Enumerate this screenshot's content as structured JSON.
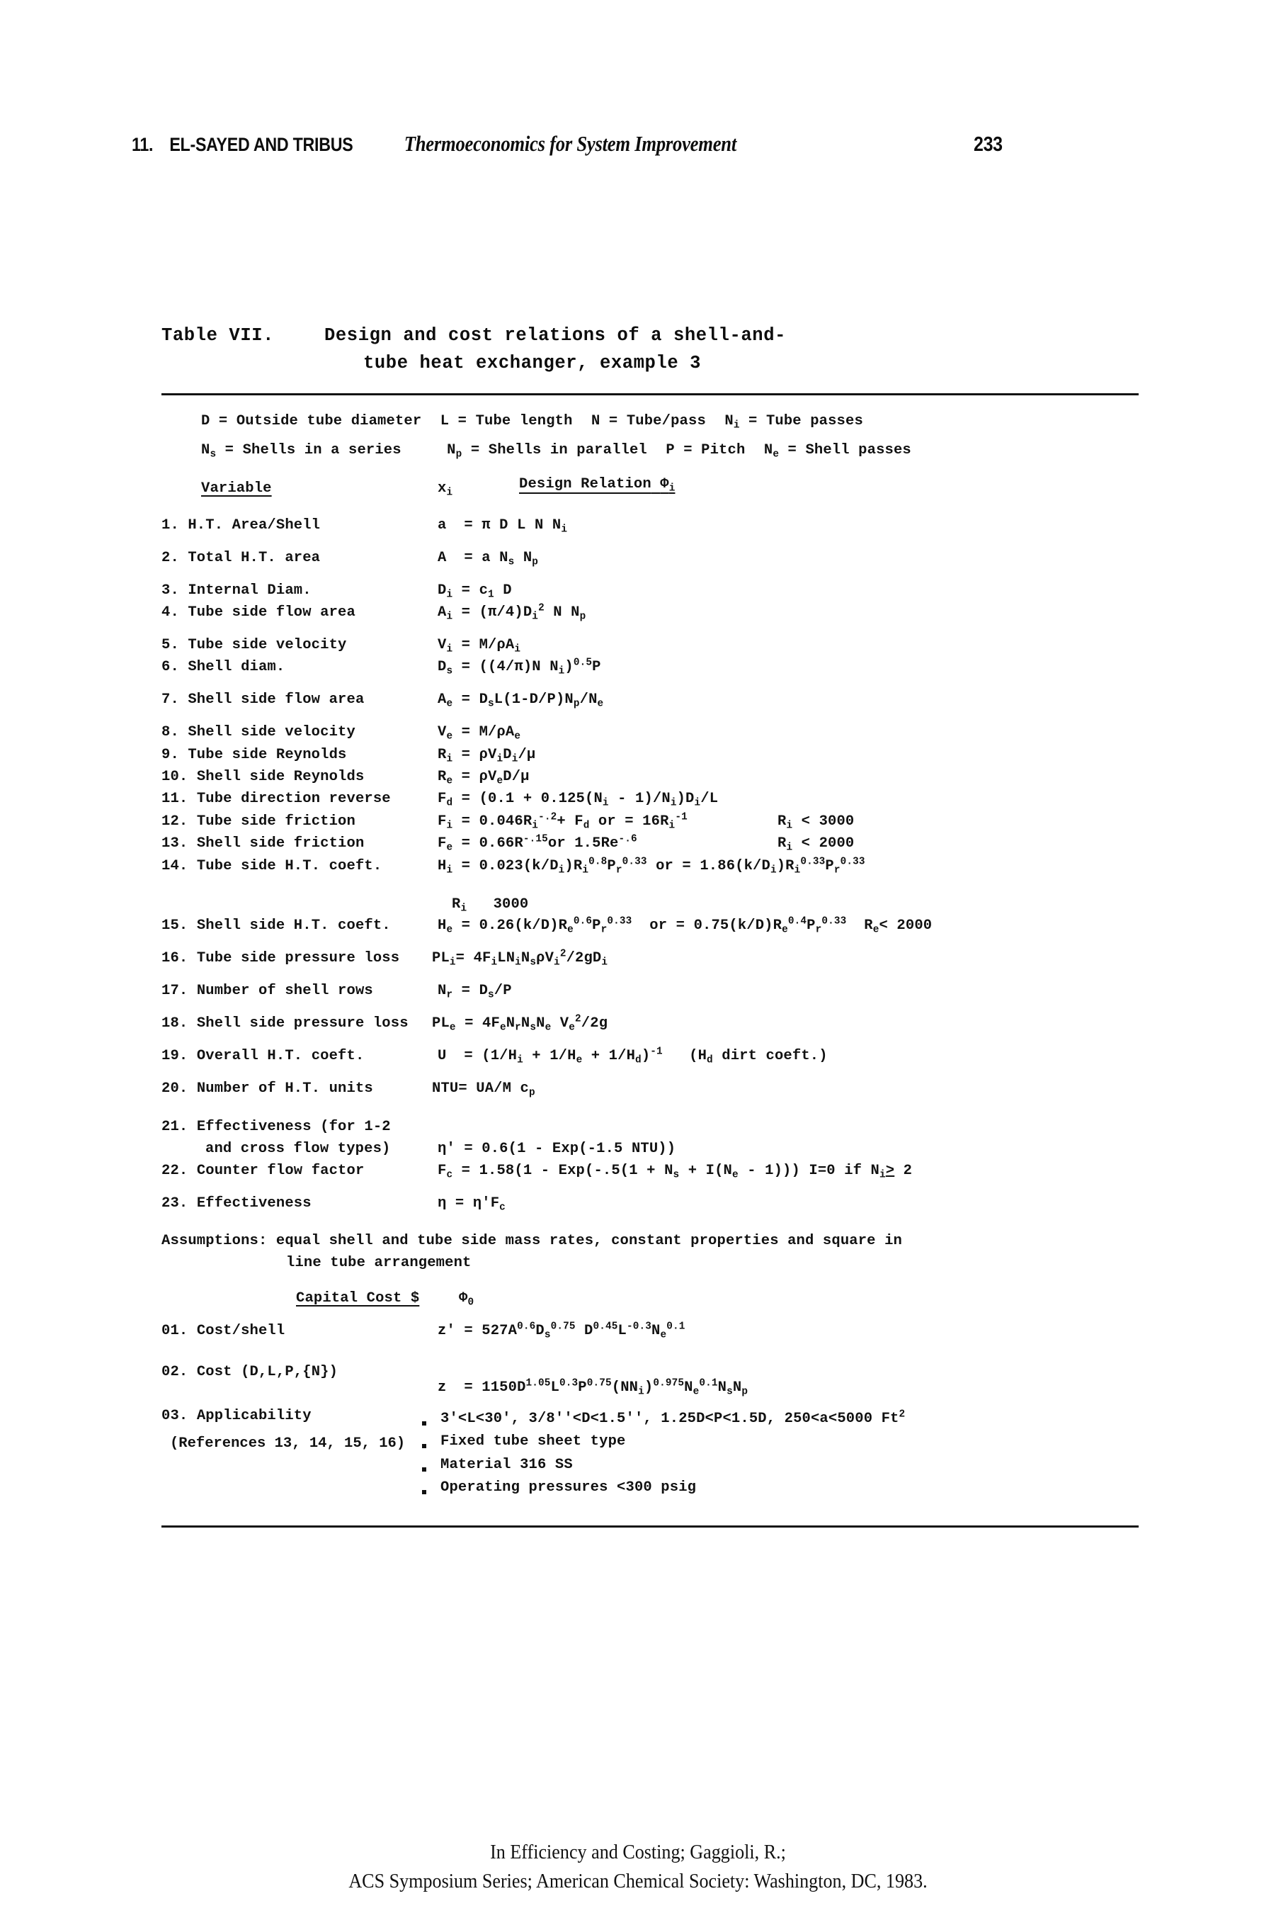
{
  "running_head": {
    "chapter_number": "11.",
    "authors": "EL-SAYED AND TRIBUS",
    "title": "Thermoeconomics for System Improvement",
    "page_number": "233"
  },
  "table": {
    "label": "Table VII.",
    "caption_line1": "Design and cost relations of a shell-and-",
    "caption_line2": "tube heat exchanger, example 3",
    "nomenclature": {
      "line1": [
        {
          "symbol": "D",
          "eq": "=",
          "text": "Outside tube diameter"
        },
        {
          "symbol": "L",
          "eq": "=",
          "text": "Tube length"
        },
        {
          "symbol": "N",
          "eq": "=",
          "text": "Tube/pass"
        },
        {
          "symbol": "N",
          "sub": "i",
          "eq": "=",
          "text": "Tube passes"
        }
      ],
      "line2": [
        {
          "symbol": "N",
          "sub": "s",
          "eq": "=",
          "text": "Shells in a series"
        },
        {
          "symbol": "N",
          "sub": "p",
          "eq": "=",
          "text": "Shells in parallel"
        },
        {
          "symbol": "P",
          "eq": "=",
          "text": "Pitch"
        },
        {
          "symbol": "N",
          "sub": "e",
          "eq": "=",
          "text": "Shell passes"
        }
      ]
    },
    "columns": {
      "variable": "Variable",
      "xi_base": "x",
      "xi_sub": "i",
      "relation": "Design Relation",
      "relation_symbol": "Φ",
      "relation_sub": "i"
    },
    "rows": [
      {
        "n": "1.",
        "name": "H.T. Area/Shell"
      },
      {
        "n": "2.",
        "name": "Total H.T. area"
      },
      {
        "n": "3.",
        "name": "Internal Diam."
      },
      {
        "n": "4.",
        "name": "Tube side flow area"
      },
      {
        "n": "5.",
        "name": "Tube side velocity"
      },
      {
        "n": "6.",
        "name": "Shell diam."
      },
      {
        "n": "7.",
        "name": "Shell side flow area"
      },
      {
        "n": "8.",
        "name": "Shell side velocity"
      },
      {
        "n": "9.",
        "name": "Tube side Reynolds"
      },
      {
        "n": "10.",
        "name": "Shell side Reynolds"
      },
      {
        "n": "11.",
        "name": "Tube direction reverse"
      },
      {
        "n": "12.",
        "name": "Tube side friction",
        "condition": "R_i < 3000"
      },
      {
        "n": "13.",
        "name": "Shell side friction",
        "condition": "R_i < 2000"
      },
      {
        "n": "14.",
        "name": "Tube side H.T. coeft.",
        "condition": "R_i  3000"
      },
      {
        "n": "15.",
        "name": "Shell side H.T. coeft.",
        "condition": "R_e< 2000"
      },
      {
        "n": "16.",
        "name": "Tube side pressure loss"
      },
      {
        "n": "17.",
        "name": "Number of shell rows"
      },
      {
        "n": "18.",
        "name": "Shell side pressure loss"
      },
      {
        "n": "19.",
        "name": "Overall H.T. coeft.",
        "note": "(H_d dirt coeft.)"
      },
      {
        "n": "20.",
        "name": "Number of H.T. units"
      },
      {
        "n": "21.",
        "name": "Effectiveness (for 1-2",
        "name2": "and cross flow types)"
      },
      {
        "n": "22.",
        "name": "Counter flow factor"
      },
      {
        "n": "23.",
        "name": "Effectiveness"
      }
    ],
    "assumptions": {
      "label": "Assumptions:",
      "line1": "equal shell and tube side mass rates, constant properties and square in",
      "line2": "line tube arrangement"
    },
    "capital_cost": {
      "heading": "Capital Cost $",
      "phi_symbol": "Φ",
      "phi_sub": "0",
      "rows": [
        {
          "n": "01.",
          "name": "Cost/shell"
        },
        {
          "n": "02.",
          "name": "Cost (D,L,P,{N})"
        },
        {
          "n": "03.",
          "name": "Applicability"
        }
      ],
      "applicability_bullets": [
        "3'<L<30', 3/8''<D<1.5'', 1.25D<P<1.5D, 250<a<5000 Ft",
        "Fixed tube sheet type",
        "Material 316 SS",
        "Operating pressures <300 psig"
      ],
      "applicability_first_sup": "2"
    },
    "references_note": "(References 13, 14, 15, 16)"
  },
  "footer": {
    "line1": "In Efficiency and Costing; Gaggioli, R.;",
    "line2": "ACS Symposium Series; American Chemical Society: Washington, DC, 1983."
  }
}
